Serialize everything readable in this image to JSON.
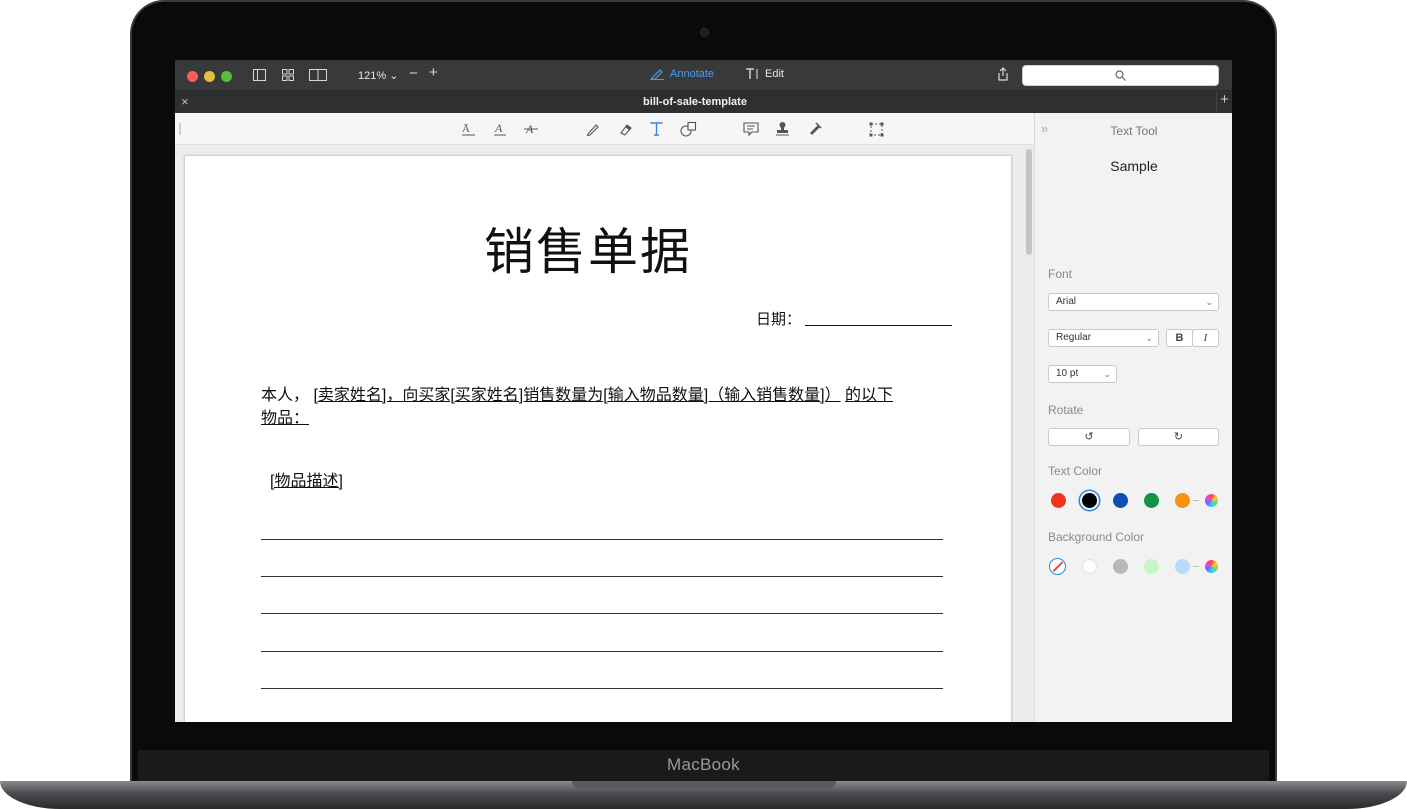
{
  "device": {
    "brand": "MacBook"
  },
  "window": {
    "zoom_label": "121%",
    "zoom_chevron": "⌄",
    "annotate_label": "Annotate",
    "edit_label": "Edit",
    "search_placeholder": "",
    "tab_title": "bill-of-sale-template",
    "tab_close": "×",
    "tab_add": "+"
  },
  "toolbar": {
    "icons": [
      "text-box-icon",
      "text-underline-icon",
      "text-strikethrough-icon",
      "pencil-icon",
      "eraser-icon",
      "text-tool-icon",
      "shapes-icon",
      "note-icon",
      "stamp-icon",
      "signature-icon",
      "selection-icon"
    ]
  },
  "document": {
    "title": "销售单据",
    "date_label": "日期：",
    "para_prefix": "本人，",
    "para_link": "[卖家姓名]，向买家[买家姓名]销售数量为[输入物品数量]（输入销售数量]）",
    "para_mid": "的以下",
    "para_end": "物品：",
    "item_desc": "[物品描述]",
    "rule_count": 5
  },
  "panel": {
    "collapse": "»",
    "title": "Text Tool",
    "sample": "Sample",
    "font_label": "Font",
    "font_value": "Arial",
    "style_value": "Regular",
    "bold": "B",
    "italic": "I",
    "size_value": "10 pt",
    "rotate_label": "Rotate",
    "rotate_left": "↺",
    "rotate_right": "↻",
    "text_color_label": "Text Color",
    "text_colors": [
      "#f0321e",
      "#000000",
      "#0f4fb4",
      "#11934a",
      "#fa9110"
    ],
    "background_color_label": "Background Color",
    "background_colors": [
      "#ffffff",
      "#b8b8b8",
      "#c6f5c8",
      "#b9dbfb"
    ]
  },
  "colors": {
    "accent": "#2e86de",
    "titlebar": "#38393b"
  }
}
